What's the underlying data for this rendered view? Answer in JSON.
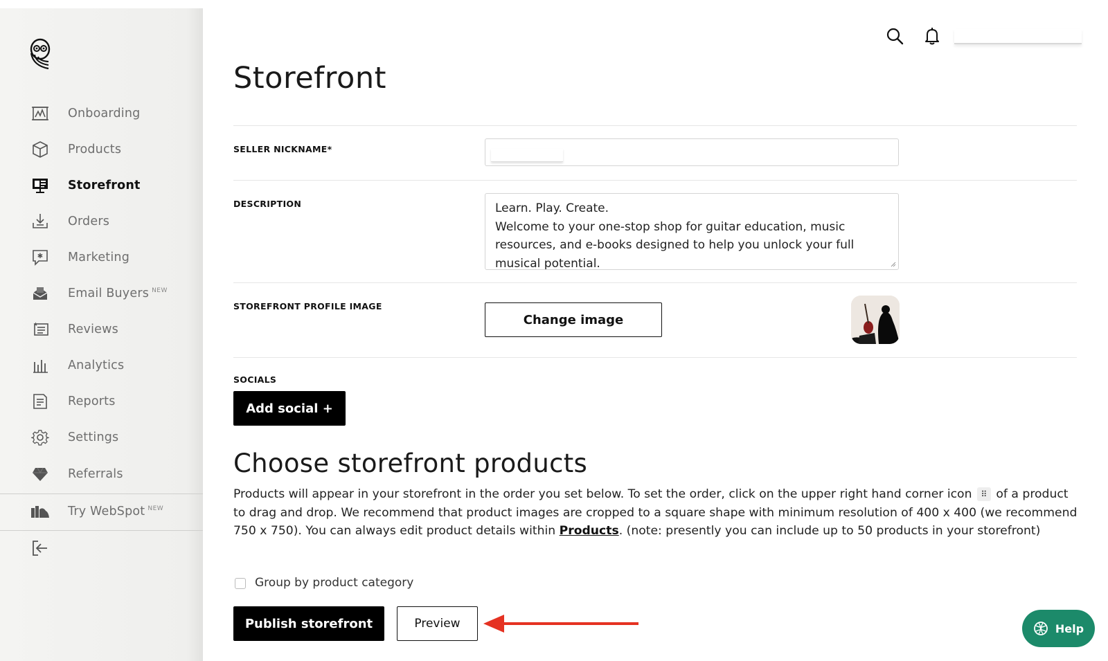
{
  "sidebar": {
    "items": [
      {
        "label": "Onboarding",
        "icon": "chart-board-icon"
      },
      {
        "label": "Products",
        "icon": "box-icon"
      },
      {
        "label": "Storefront",
        "icon": "storefront-icon",
        "active": true
      },
      {
        "label": "Orders",
        "icon": "download-tray-icon"
      },
      {
        "label": "Marketing",
        "icon": "megaphone-chat-icon"
      },
      {
        "label": "Email Buyers",
        "icon": "mail-icon",
        "badge": "NEW"
      },
      {
        "label": "Reviews",
        "icon": "reviews-list-icon"
      },
      {
        "label": "Analytics",
        "icon": "bar-chart-icon"
      },
      {
        "label": "Reports",
        "icon": "report-doc-icon"
      },
      {
        "label": "Settings",
        "icon": "gear-icon"
      },
      {
        "label": "Referrals",
        "icon": "heart-gem-icon"
      }
    ],
    "webspot": {
      "label": "Try WebSpot",
      "badge": "NEW"
    },
    "logout_icon": "logout-icon"
  },
  "topbar": {
    "search_icon": "search-icon",
    "bell_icon": "bell-icon"
  },
  "page": {
    "title": "Storefront"
  },
  "form": {
    "nickname_label": "SELLER NICKNAME*",
    "description_label": "DESCRIPTION",
    "description_value": "Learn. Play. Create.\nWelcome to your one-stop shop for guitar education, music resources, and e-books designed to help you unlock your full musical potential.",
    "profile_image_label": "STOREFRONT PROFILE IMAGE",
    "change_image_label": "Change image",
    "socials_label": "SOCIALS",
    "add_social_label": "Add social +"
  },
  "products_section": {
    "title": "Choose storefront products",
    "para_part1": "Products will appear in your storefront in the order you set below. To set the order, click on the upper right hand corner icon",
    "drag_icon_glyph": "⠿",
    "para_part2": "of a product to drag and drop. We recommend that product images are cropped to a square shape with minimum resolution of 400 x 400 (we recommend 750 x 750). You can always edit product details within",
    "products_link": "Products",
    "para_part3": ". (note: presently you can include up to 50 products in your storefront)",
    "group_by_label": "Group by product category",
    "publish_label": "Publish storefront",
    "preview_label": "Preview"
  },
  "help": {
    "label": "Help"
  },
  "colors": {
    "accent": "#000000",
    "help_green": "#1c8a6a",
    "arrow_red": "#e53222"
  }
}
